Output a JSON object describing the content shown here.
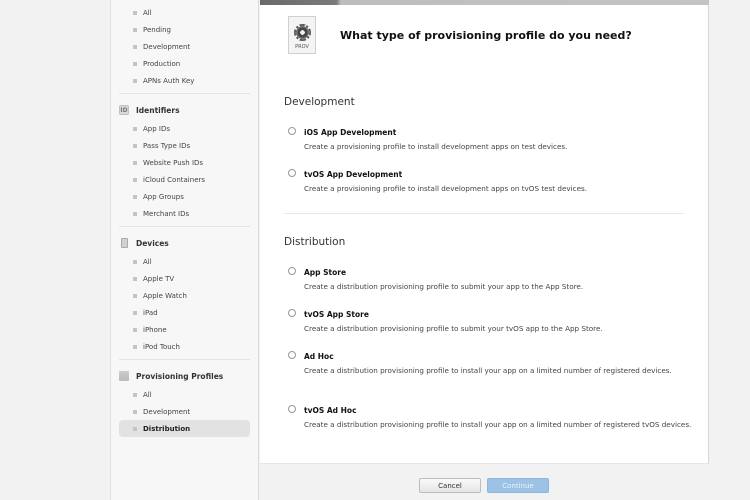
{
  "sidebar": {
    "certificates_items": [
      "All",
      "Pending",
      "Development",
      "Production",
      "APNs Auth Key"
    ],
    "identifiers": {
      "title": "Identifiers",
      "items": [
        "App IDs",
        "Pass Type IDs",
        "Website Push IDs",
        "iCloud Containers",
        "App Groups",
        "Merchant IDs"
      ]
    },
    "devices": {
      "title": "Devices",
      "items": [
        "All",
        "Apple TV",
        "Apple Watch",
        "iPad",
        "iPhone",
        "iPod Touch"
      ]
    },
    "provisioning": {
      "title": "Provisioning Profiles",
      "items": [
        "All",
        "Development",
        "Distribution"
      ],
      "active": "Distribution"
    }
  },
  "main": {
    "icon_label": "PROV",
    "title": "What type of provisioning profile do you need?",
    "development": {
      "heading": "Development",
      "options": [
        {
          "label": "iOS App Development",
          "desc": "Create a provisioning profile to install development apps on test devices."
        },
        {
          "label": "tvOS App Development",
          "desc": "Create a provisioning profile to install development apps on tvOS test devices."
        }
      ]
    },
    "distribution": {
      "heading": "Distribution",
      "options": [
        {
          "label": "App Store",
          "desc": "Create a distribution provisioning profile to submit your app to the App Store."
        },
        {
          "label": "tvOS App Store",
          "desc": "Create a distribution provisioning profile to submit your tvOS app to the App Store."
        },
        {
          "label": "Ad Hoc",
          "desc": "Create a distribution provisioning profile to install your app on a limited number of registered devices."
        },
        {
          "label": "tvOS Ad Hoc",
          "desc": "Create a distribution provisioning profile to install your app on a limited number of registered tvOS devices."
        }
      ]
    }
  },
  "footer": {
    "cancel_label": "Cancel",
    "continue_label": "Continue"
  },
  "colors": {
    "continue_button": "#9cc3e6",
    "active_item_bg": "#e2e2e2"
  }
}
